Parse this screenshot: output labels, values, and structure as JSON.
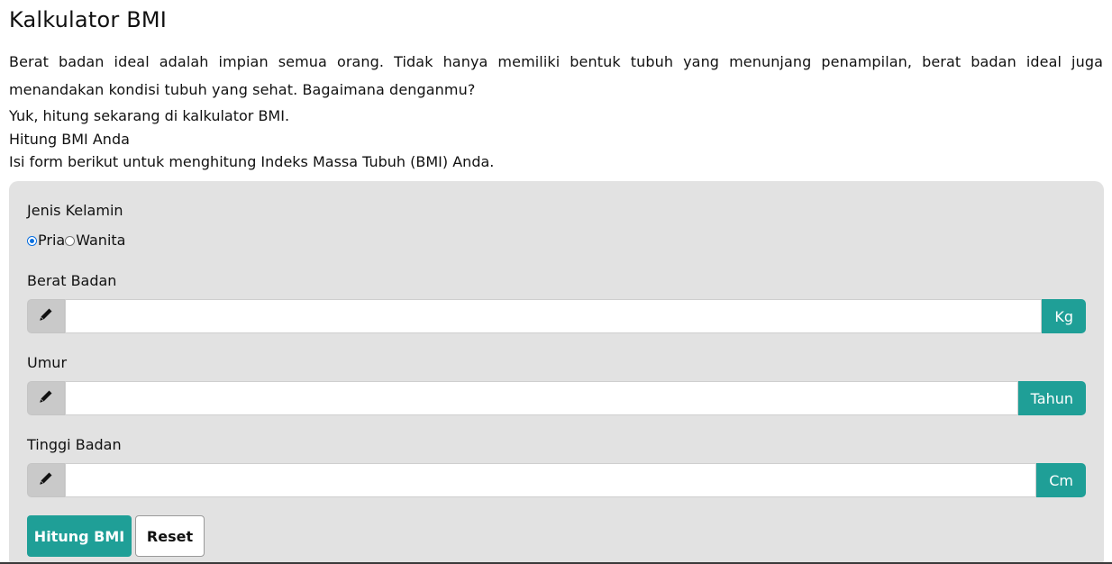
{
  "page": {
    "title": "Kalkulator BMI",
    "intro": "Berat badan ideal adalah impian semua orang. Tidak hanya memiliki bentuk tubuh yang menunjang penampilan, berat badan ideal juga menandakan kondisi tubuh yang sehat. Bagaimana denganmu?",
    "cta": "Yuk, hitung sekarang di kalkulator BMI.",
    "section_title": "Hitung BMI Anda",
    "section_desc": "Isi form berikut untuk menghitung Indeks Massa Tubuh (BMI) Anda."
  },
  "form": {
    "gender": {
      "label": "Jenis Kelamin",
      "options": [
        {
          "label": "Pria",
          "checked": true
        },
        {
          "label": "Wanita",
          "checked": false
        }
      ]
    },
    "weight": {
      "label": "Berat Badan",
      "value": "",
      "unit": "Kg",
      "icon": "pencil-icon"
    },
    "age": {
      "label": "Umur",
      "value": "",
      "unit": "Tahun",
      "icon": "pencil-icon"
    },
    "height": {
      "label": "Tinggi Badan",
      "value": "",
      "unit": "Cm",
      "icon": "pencil-icon"
    },
    "submit_label": "Hitung BMI",
    "reset_label": "Reset"
  },
  "colors": {
    "accent": "#1f9f97",
    "card_bg": "#e2e2e2",
    "addon_bg": "#c9c9c9",
    "radio_checked": "#0b6fde"
  }
}
